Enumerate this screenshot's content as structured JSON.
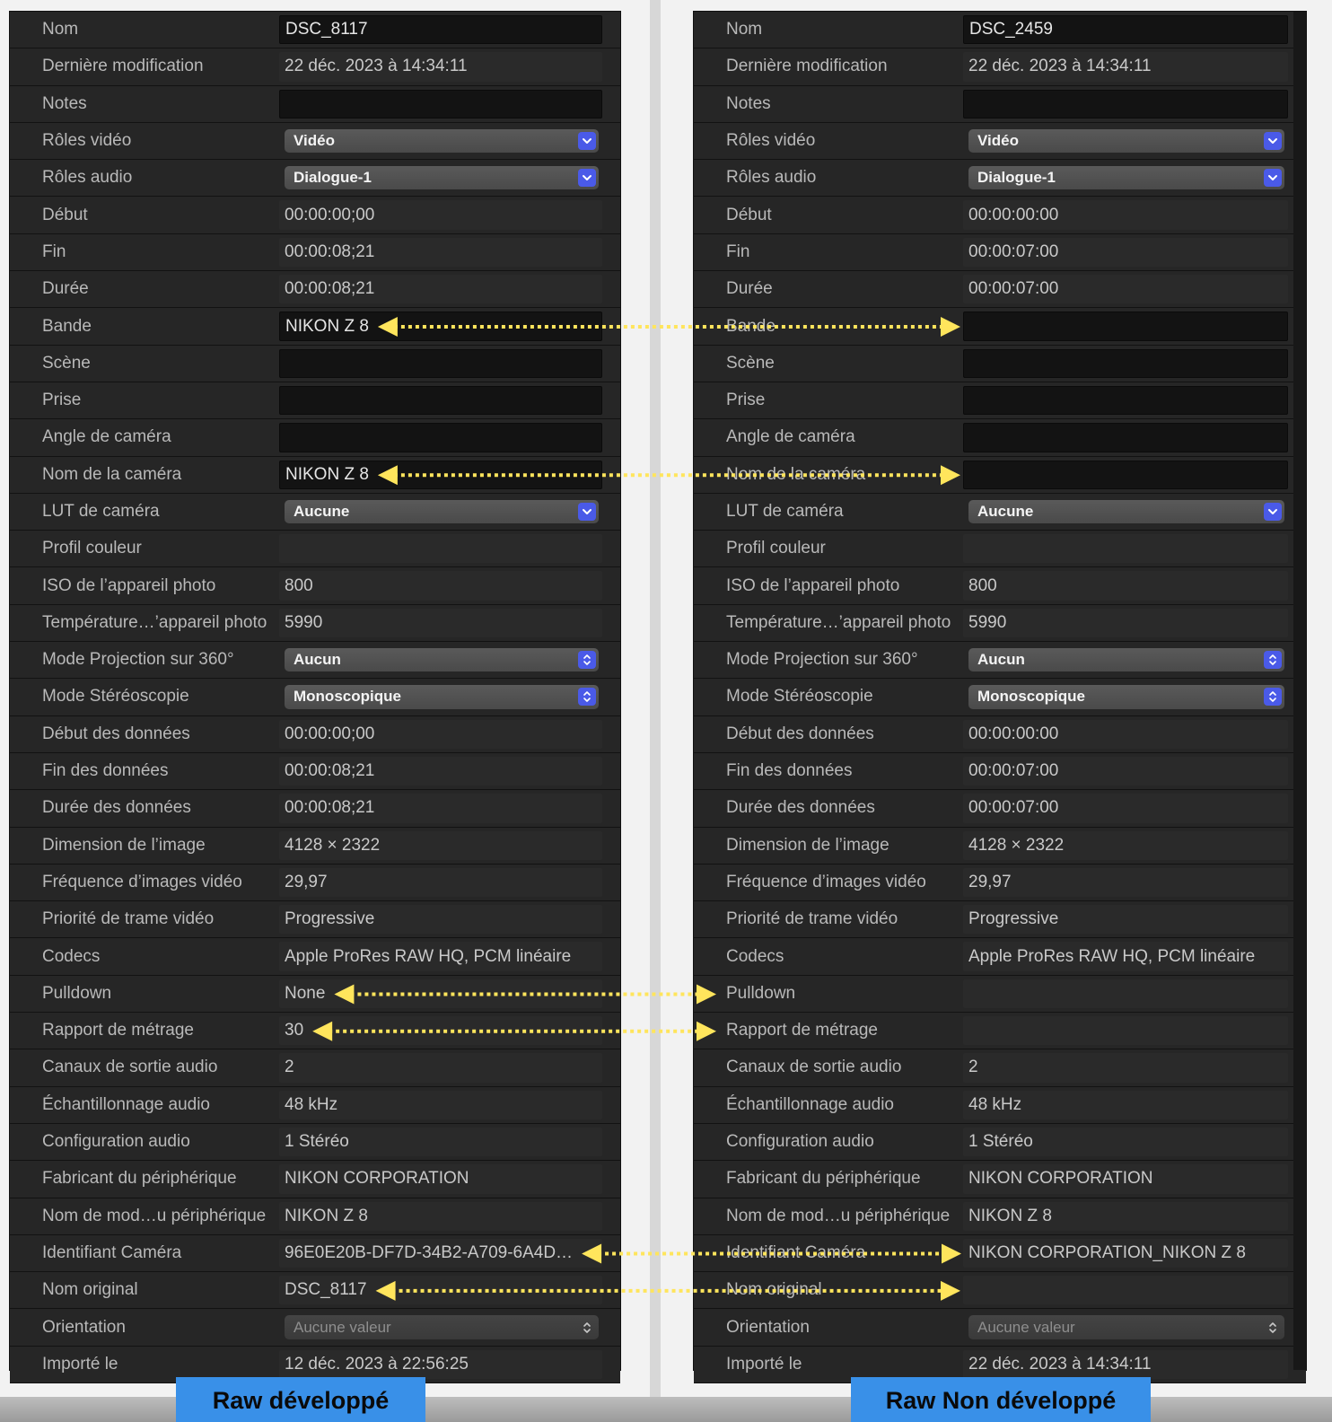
{
  "left_panel": {
    "caption": "Raw développé",
    "rows": [
      {
        "label": "Nom",
        "value": "DSC_8117",
        "kind": "field"
      },
      {
        "label": "Dernière modification",
        "value": "22 déc. 2023 à 14:34:11",
        "kind": "text"
      },
      {
        "label": "Notes",
        "value": "",
        "kind": "field"
      },
      {
        "label": "Rôles vidéo",
        "value": "Vidéo",
        "kind": "popup-blue"
      },
      {
        "label": "Rôles audio",
        "value": "Dialogue-1",
        "kind": "popup-blue"
      },
      {
        "label": "Début",
        "value": "00:00:00;00",
        "kind": "text"
      },
      {
        "label": "Fin",
        "value": "00:00:08;21",
        "kind": "text"
      },
      {
        "label": "Durée",
        "value": "00:00:08;21",
        "kind": "text"
      },
      {
        "label": "Bande",
        "value": "NIKON Z 8",
        "kind": "field"
      },
      {
        "label": "Scène",
        "value": "",
        "kind": "field"
      },
      {
        "label": "Prise",
        "value": "",
        "kind": "field"
      },
      {
        "label": "Angle de caméra",
        "value": "",
        "kind": "field"
      },
      {
        "label": "Nom de la caméra",
        "value": "NIKON Z 8",
        "kind": "field"
      },
      {
        "label": "LUT de caméra",
        "value": "Aucune",
        "kind": "popup-blue"
      },
      {
        "label": "Profil couleur",
        "value": "",
        "kind": "text"
      },
      {
        "label": "ISO de l’appareil photo",
        "value": "800",
        "kind": "text"
      },
      {
        "label": "Température…’appareil photo",
        "value": "5990",
        "kind": "text"
      },
      {
        "label": "Mode Projection sur 360°",
        "value": "Aucun",
        "kind": "popup-updown"
      },
      {
        "label": "Mode Stéréoscopie",
        "value": "Monoscopique",
        "kind": "popup-updown"
      },
      {
        "label": "Début des données",
        "value": "00:00:00;00",
        "kind": "text"
      },
      {
        "label": "Fin des données",
        "value": "00:00:08;21",
        "kind": "text"
      },
      {
        "label": "Durée des données",
        "value": "00:00:08;21",
        "kind": "text"
      },
      {
        "label": "Dimension de l’image",
        "value": "4128 × 2322",
        "kind": "text"
      },
      {
        "label": "Fréquence d’images vidéo",
        "value": "29,97",
        "kind": "text"
      },
      {
        "label": "Priorité de trame vidéo",
        "value": "Progressive",
        "kind": "text"
      },
      {
        "label": "Codecs",
        "value": "Apple ProRes RAW HQ, PCM linéaire",
        "kind": "text"
      },
      {
        "label": "Pulldown",
        "value": "None",
        "kind": "text"
      },
      {
        "label": "Rapport de métrage",
        "value": "30",
        "kind": "text"
      },
      {
        "label": "Canaux de sortie audio",
        "value": "2",
        "kind": "text"
      },
      {
        "label": "Échantillonnage audio",
        "value": "48 kHz",
        "kind": "text"
      },
      {
        "label": "Configuration audio",
        "value": "1 Stéréo",
        "kind": "text"
      },
      {
        "label": "Fabricant du périphérique",
        "value": "NIKON CORPORATION",
        "kind": "text"
      },
      {
        "label": "Nom de mod…u périphérique",
        "value": "NIKON Z 8",
        "kind": "text"
      },
      {
        "label": "Identifiant Caméra",
        "value": "96E0E20B-DF7D-34B2-A709-6A4D…",
        "kind": "text"
      },
      {
        "label": "Nom original",
        "value": "DSC_8117",
        "kind": "text"
      },
      {
        "label": "Orientation",
        "value": "Aucune valeur",
        "kind": "popup-dim"
      },
      {
        "label": "Importé le",
        "value": "12 déc. 2023 à 22:56:25",
        "kind": "text"
      }
    ]
  },
  "right_panel": {
    "caption": "Raw Non développé",
    "rows": [
      {
        "label": "Nom",
        "value": "DSC_2459",
        "kind": "field"
      },
      {
        "label": "Dernière modification",
        "value": "22 déc. 2023 à 14:34:11",
        "kind": "text"
      },
      {
        "label": "Notes",
        "value": "",
        "kind": "field"
      },
      {
        "label": "Rôles vidéo",
        "value": "Vidéo",
        "kind": "popup-blue"
      },
      {
        "label": "Rôles audio",
        "value": "Dialogue-1",
        "kind": "popup-blue"
      },
      {
        "label": "Début",
        "value": "00:00:00:00",
        "kind": "text"
      },
      {
        "label": "Fin",
        "value": "00:00:07:00",
        "kind": "text"
      },
      {
        "label": "Durée",
        "value": "00:00:07:00",
        "kind": "text"
      },
      {
        "label": "Bande",
        "value": "",
        "kind": "field"
      },
      {
        "label": "Scène",
        "value": "",
        "kind": "field"
      },
      {
        "label": "Prise",
        "value": "",
        "kind": "field"
      },
      {
        "label": "Angle de caméra",
        "value": "",
        "kind": "field"
      },
      {
        "label": "Nom de la caméra",
        "value": "",
        "kind": "field"
      },
      {
        "label": "LUT de caméra",
        "value": "Aucune",
        "kind": "popup-blue"
      },
      {
        "label": "Profil couleur",
        "value": "",
        "kind": "text"
      },
      {
        "label": "ISO de l’appareil photo",
        "value": "800",
        "kind": "text"
      },
      {
        "label": "Température…’appareil photo",
        "value": "5990",
        "kind": "text"
      },
      {
        "label": "Mode Projection sur 360°",
        "value": "Aucun",
        "kind": "popup-updown"
      },
      {
        "label": "Mode Stéréoscopie",
        "value": "Monoscopique",
        "kind": "popup-updown"
      },
      {
        "label": "Début des données",
        "value": "00:00:00:00",
        "kind": "text"
      },
      {
        "label": "Fin des données",
        "value": "00:00:07:00",
        "kind": "text"
      },
      {
        "label": "Durée des données",
        "value": "00:00:07:00",
        "kind": "text"
      },
      {
        "label": "Dimension de l’image",
        "value": "4128 × 2322",
        "kind": "text"
      },
      {
        "label": "Fréquence d’images vidéo",
        "value": "29,97",
        "kind": "text"
      },
      {
        "label": "Priorité de trame vidéo",
        "value": "Progressive",
        "kind": "text"
      },
      {
        "label": "Codecs",
        "value": "Apple ProRes RAW HQ, PCM linéaire",
        "kind": "text"
      },
      {
        "label": "Pulldown",
        "value": "",
        "kind": "text"
      },
      {
        "label": "Rapport de métrage",
        "value": "",
        "kind": "text"
      },
      {
        "label": "Canaux de sortie audio",
        "value": "2",
        "kind": "text"
      },
      {
        "label": "Échantillonnage audio",
        "value": "48 kHz",
        "kind": "text"
      },
      {
        "label": "Configuration audio",
        "value": "1 Stéréo",
        "kind": "text"
      },
      {
        "label": "Fabricant du périphérique",
        "value": "NIKON CORPORATION",
        "kind": "text"
      },
      {
        "label": "Nom de mod…u périphérique",
        "value": "NIKON Z 8",
        "kind": "text"
      },
      {
        "label": "Identifiant Caméra",
        "value": "NIKON CORPORATION_NIKON Z 8",
        "kind": "text"
      },
      {
        "label": "Nom original",
        "value": "",
        "kind": "text"
      },
      {
        "label": "Orientation",
        "value": "Aucune valeur",
        "kind": "popup-dim"
      },
      {
        "label": "Importé le",
        "value": "22 déc. 2023 à 14:34:11",
        "kind": "text"
      }
    ]
  },
  "comparison_arrows": {
    "color": "#ffe55c",
    "rows": [
      "Bande",
      "Nom de la caméra",
      "Pulldown",
      "Rapport de métrage",
      "Identifiant Caméra",
      "Nom original"
    ]
  },
  "colors": {
    "panel_bg": "#262626",
    "popup_button": "#4a5ae8",
    "caption_bg": "#3990e8"
  }
}
